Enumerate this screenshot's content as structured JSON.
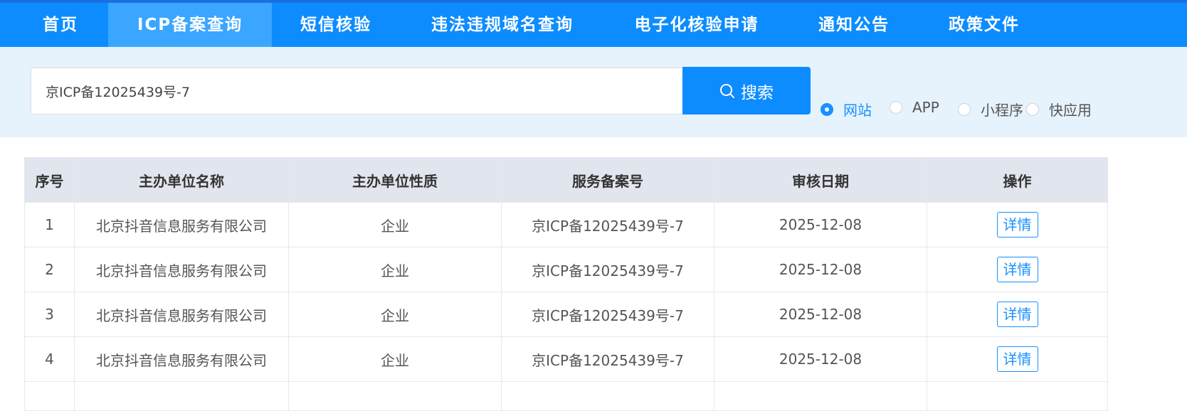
{
  "nav": {
    "items": [
      {
        "label": "首页",
        "active": false
      },
      {
        "label": "ICP备案查询",
        "active": true
      },
      {
        "label": "短信核验",
        "active": false
      },
      {
        "label": "违法违规域名查询",
        "active": false
      },
      {
        "label": "电子化核验申请",
        "active": false
      },
      {
        "label": "通知公告",
        "active": false
      },
      {
        "label": "政策文件",
        "active": false
      }
    ]
  },
  "search": {
    "value": "京ICP备12025439号-7",
    "button_label": "搜索",
    "button_icon": "search-icon",
    "options": [
      {
        "label": "网站",
        "checked": true
      },
      {
        "label": "APP",
        "checked": false
      },
      {
        "label": "小程序",
        "checked": false
      },
      {
        "label": "快应用",
        "checked": false
      }
    ]
  },
  "table": {
    "headers": [
      "序号",
      "主办单位名称",
      "主办单位性质",
      "服务备案号",
      "审核日期",
      "操作"
    ],
    "rows": [
      {
        "index": "1",
        "name": "北京抖音信息服务有限公司",
        "type": "企业",
        "record": "京ICP备12025439号-7",
        "date": "2025-12-08",
        "action": "详情"
      },
      {
        "index": "2",
        "name": "北京抖音信息服务有限公司",
        "type": "企业",
        "record": "京ICP备12025439号-7",
        "date": "2025-12-08",
        "action": "详情"
      },
      {
        "index": "3",
        "name": "北京抖音信息服务有限公司",
        "type": "企业",
        "record": "京ICP备12025439号-7",
        "date": "2025-12-08",
        "action": "详情"
      },
      {
        "index": "4",
        "name": "北京抖音信息服务有限公司",
        "type": "企业",
        "record": "京ICP备12025439号-7",
        "date": "2025-12-08",
        "action": "详情"
      }
    ]
  },
  "colors": {
    "primary": "#0d8cff",
    "nav_active": "#3aa6ff",
    "search_band": "#e6f2fc",
    "table_header": "#e1e5ee"
  }
}
